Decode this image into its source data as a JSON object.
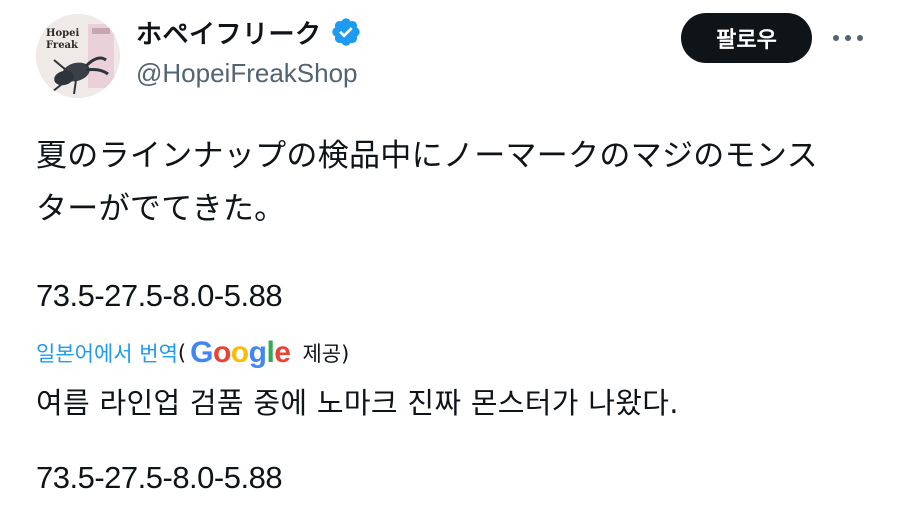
{
  "author": {
    "display_name": "ホペイフリーク",
    "handle": "@HopeiFreakShop",
    "avatar_text_line1": "Hopei",
    "avatar_text_line2": "Freak",
    "verified_icon": "verified-badge-icon"
  },
  "actions": {
    "follow_label": "팔로우",
    "more_icon": "more-dots-icon"
  },
  "post": {
    "text_line1": "夏のラインナップの検品中にノーマークのマジのモン",
    "text_line1_end": "ス",
    "text_line2": "ターがでてきた。",
    "numbers": "73.5-27.5-8.0-5.88"
  },
  "translation": {
    "link_label": "일본어에서 번역",
    "paren_open": "(",
    "google_g": "G",
    "google_o1": "o",
    "google_o2": "o",
    "google_g2": "g",
    "google_l": "l",
    "google_e": "e",
    "provided_label": "제공)",
    "text": "여름 라인업 검품 중에 노마크 진짜 몬스터가 나왔다.",
    "numbers": "73.5-27.5-8.0-5.88"
  },
  "colors": {
    "verified": "#1d9bf0",
    "link": "#1d9bf0",
    "follow_bg": "#0f1419",
    "secondary_text": "#536471"
  }
}
